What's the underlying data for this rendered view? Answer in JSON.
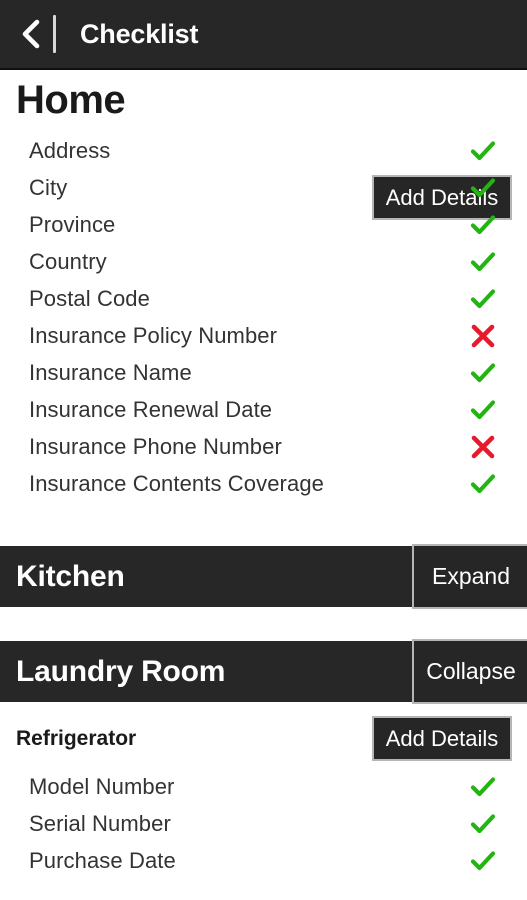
{
  "header": {
    "back_icon": "chevron-left-icon",
    "title": "Checklist"
  },
  "colors": {
    "bar_dark": "#272727",
    "button_fill": "#262626",
    "button_border": "#b5b5b5",
    "check_green": "#22b512",
    "cross_red": "#e8192c",
    "page_bg": "#ffffff",
    "text_dark": "#333333"
  },
  "sections": [
    {
      "id": "home",
      "type": "open",
      "title": "Home",
      "action_label": "Add Details",
      "items": [
        {
          "label": "Address",
          "status": "check"
        },
        {
          "label": "City",
          "status": "check"
        },
        {
          "label": "Province",
          "status": "check"
        },
        {
          "label": "Country",
          "status": "check"
        },
        {
          "label": "Postal Code",
          "status": "check"
        },
        {
          "label": "Insurance Policy Number",
          "status": "cross"
        },
        {
          "label": "Insurance Name",
          "status": "check"
        },
        {
          "label": "Insurance Renewal Date",
          "status": "check"
        },
        {
          "label": "Insurance Phone Number",
          "status": "cross"
        },
        {
          "label": "Insurance Contents Coverage",
          "status": "check"
        }
      ]
    },
    {
      "id": "kitchen",
      "type": "collapsed",
      "title": "Kitchen",
      "action_label": "Expand"
    },
    {
      "id": "laundry-room",
      "type": "expanded",
      "title": "Laundry Room",
      "action_label": "Collapse",
      "groups": [
        {
          "title": "Refrigerator",
          "action_label": "Add Details",
          "items": [
            {
              "label": "Model Number",
              "status": "check"
            },
            {
              "label": "Serial Number",
              "status": "check"
            },
            {
              "label": "Purchase Date",
              "status": "check"
            }
          ]
        }
      ]
    }
  ]
}
